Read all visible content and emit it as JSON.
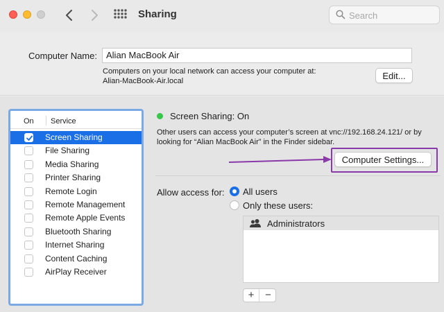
{
  "window": {
    "title": "Sharing",
    "search_placeholder": "Search"
  },
  "computer_name": {
    "label": "Computer Name:",
    "value": "Alian MacBook Air",
    "description_line1": "Computers on your local network can access your computer at:",
    "description_line2": "Alian-MacBook-Air.local",
    "edit_label": "Edit..."
  },
  "services": {
    "header_on": "On",
    "header_service": "Service",
    "items": [
      {
        "name": "Screen Sharing",
        "checked": true,
        "selected": true
      },
      {
        "name": "File Sharing",
        "checked": false,
        "selected": false
      },
      {
        "name": "Media Sharing",
        "checked": false,
        "selected": false
      },
      {
        "name": "Printer Sharing",
        "checked": false,
        "selected": false
      },
      {
        "name": "Remote Login",
        "checked": false,
        "selected": false
      },
      {
        "name": "Remote Management",
        "checked": false,
        "selected": false
      },
      {
        "name": "Remote Apple Events",
        "checked": false,
        "selected": false
      },
      {
        "name": "Bluetooth Sharing",
        "checked": false,
        "selected": false
      },
      {
        "name": "Internet Sharing",
        "checked": false,
        "selected": false
      },
      {
        "name": "Content Caching",
        "checked": false,
        "selected": false
      },
      {
        "name": "AirPlay Receiver",
        "checked": false,
        "selected": false
      }
    ]
  },
  "detail": {
    "status": "Screen Sharing: On",
    "status_color": "#34c749",
    "info_line1": "Other users can access your computer’s screen at vnc://192.168.24.121/ or by",
    "info_line2": "looking for “Alian MacBook Air” in the Finder sidebar.",
    "computer_settings_label": "Computer Settings...",
    "highlight_color": "#8a39a8",
    "access_label": "Allow access for:",
    "radio_all_label": "All users",
    "radio_only_label": "Only these users:",
    "selected_radio": "All users",
    "users": [
      {
        "name": "Administrators",
        "icon": "group-icon"
      }
    ],
    "add_label": "+",
    "remove_label": "−"
  },
  "colors": {
    "accent": "#1a6ee6",
    "list_focus_ring": "#7ba9e6"
  }
}
